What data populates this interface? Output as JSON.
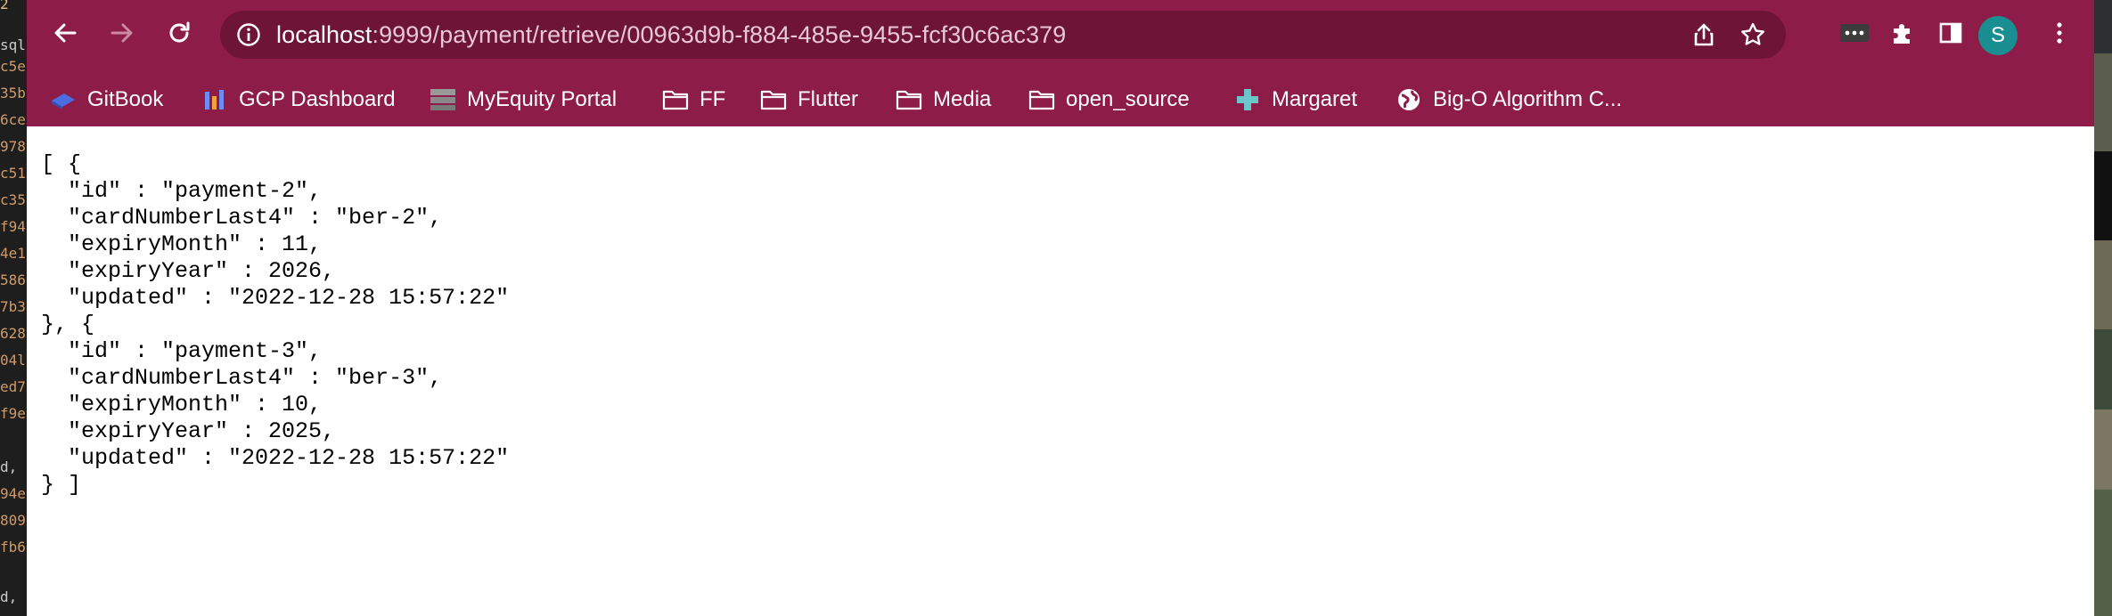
{
  "background": {
    "editor_fragments": [
      "2",
      "sql",
      "c5e",
      "35b",
      "6ce",
      "978",
      "c51",
      "c35",
      "f94",
      "4e1",
      "586",
      "7b3",
      "628",
      "04l",
      "ed7",
      "f9e",
      "",
      "d,",
      "94e",
      "809",
      "fb6",
      "",
      "",
      "d,"
    ]
  },
  "browser": {
    "url_host": "localhost",
    "url_rest": ":9999/payment/retrieve/00963d9b-f884-485e-9455-fcf30c6ac379",
    "profile_initial": "S",
    "colors": {
      "toolbar": "#8d1d48",
      "omnibox": "#6e1436",
      "avatar": "#1a8f92"
    }
  },
  "bookmarks": [
    {
      "label": "GitBook",
      "icon": "gitbook-icon"
    },
    {
      "label": "GCP Dashboard",
      "icon": "gcp-dashboard-icon"
    },
    {
      "label": "MyEquity Portal",
      "icon": "myequity-icon"
    },
    {
      "label": "FF",
      "icon": "folder-icon"
    },
    {
      "label": "Flutter",
      "icon": "folder-icon"
    },
    {
      "label": "Media",
      "icon": "folder-icon"
    },
    {
      "label": "open_source",
      "icon": "folder-icon"
    },
    {
      "label": "Margaret",
      "icon": "margaret-icon"
    },
    {
      "label": "Big-O Algorithm C...",
      "icon": "globe-icon"
    }
  ],
  "json_body": "[ {\n  \"id\" : \"payment-2\",\n  \"cardNumberLast4\" : \"ber-2\",\n  \"expiryMonth\" : 11,\n  \"expiryYear\" : 2026,\n  \"updated\" : \"2022-12-28 15:57:22\"\n}, {\n  \"id\" : \"payment-3\",\n  \"cardNumberLast4\" : \"ber-3\",\n  \"expiryMonth\" : 10,\n  \"expiryYear\" : 2025,\n  \"updated\" : \"2022-12-28 15:57:22\"\n} ]"
}
